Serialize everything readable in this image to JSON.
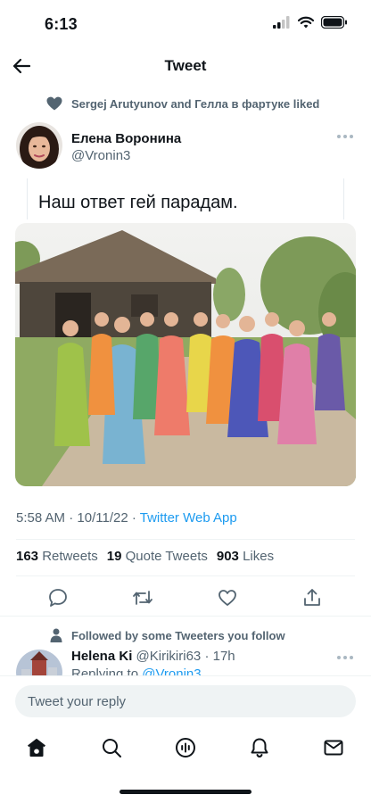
{
  "status_bar": {
    "time": "6:13"
  },
  "nav": {
    "title": "Tweet"
  },
  "social_context": {
    "text": "Sergej Arutyunov and Гелла в фартуке liked"
  },
  "tweet": {
    "author_name": "Елена Воронина",
    "author_handle": "@Vronin3",
    "text": "Наш ответ гей парадам.",
    "time": "5:58 AM",
    "date": "10/11/22",
    "source": "Twitter Web App",
    "retweets_count": "163",
    "retweets_label": "Retweets",
    "quote_count": "19",
    "quote_label": "Quote Tweets",
    "likes_count": "903",
    "likes_label": "Likes"
  },
  "reply_context": {
    "text": "Followed by some Tweeters you follow"
  },
  "reply": {
    "name": "Helena Ki",
    "handle": "@Kirikiri63",
    "age": "17h",
    "replying_prefix": "Replying to",
    "replying_to": "@Vronin3"
  },
  "composer": {
    "placeholder": "Tweet your reply"
  },
  "colors": {
    "accent": "#1d9bf0",
    "muted": "#536471",
    "text": "#0f1419"
  },
  "icons": {
    "back": "arrow-left-icon",
    "heart": "heart-icon",
    "reply": "comment-icon",
    "retweet": "retweet-icon",
    "share": "share-icon",
    "home": "home-icon",
    "search": "search-icon",
    "spaces": "spaces-icon",
    "notifications": "bell-icon",
    "messages": "mail-icon"
  }
}
